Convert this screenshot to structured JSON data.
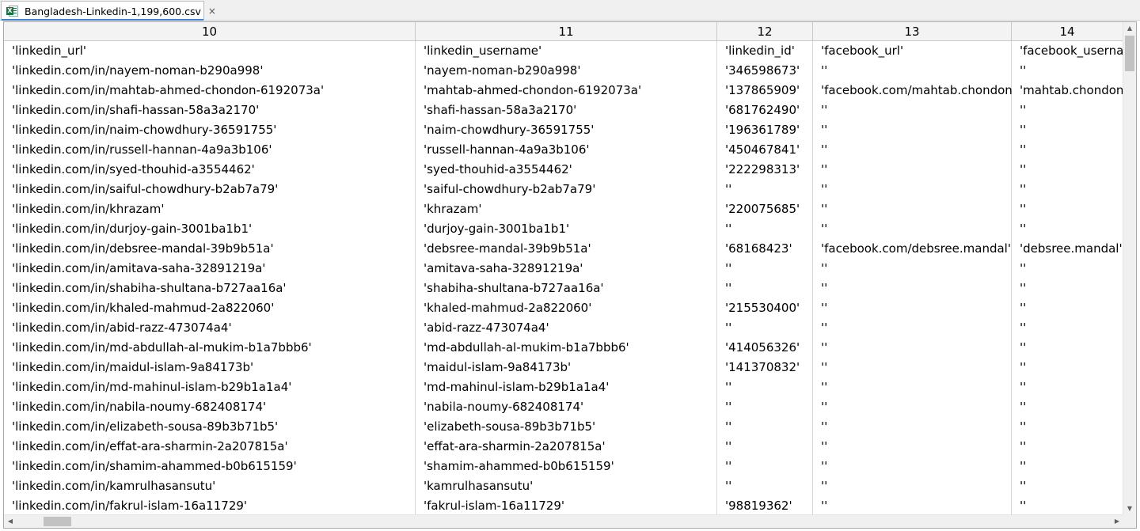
{
  "tab": {
    "title": "Bangladesh-Linkedin-1,199,600.csv",
    "close": "×",
    "icon": "excel-csv-icon",
    "icon_badge": "X"
  },
  "columns": [
    "10",
    "11",
    "12",
    "13",
    "14"
  ],
  "rows": [
    [
      "'linkedin_url'",
      "'linkedin_username'",
      "'linkedin_id'",
      "'facebook_url'",
      "'facebook_usernam"
    ],
    [
      "'linkedin.com/in/nayem-noman-b290a998'",
      "'nayem-noman-b290a998'",
      "'346598673'",
      "''",
      "''"
    ],
    [
      "'linkedin.com/in/mahtab-ahmed-chondon-6192073a'",
      "'mahtab-ahmed-chondon-6192073a'",
      "'137865909'",
      "'facebook.com/mahtab.chondon'",
      "'mahtab.chondon'"
    ],
    [
      "'linkedin.com/in/shafi-hassan-58a3a2170'",
      "'shafi-hassan-58a3a2170'",
      "'681762490'",
      "''",
      "''"
    ],
    [
      "'linkedin.com/in/naim-chowdhury-36591755'",
      "'naim-chowdhury-36591755'",
      "'196361789'",
      "''",
      "''"
    ],
    [
      "'linkedin.com/in/russell-hannan-4a9a3b106'",
      "'russell-hannan-4a9a3b106'",
      "'450467841'",
      "''",
      "''"
    ],
    [
      "'linkedin.com/in/syed-thouhid-a3554462'",
      "'syed-thouhid-a3554462'",
      "'222298313'",
      "''",
      "''"
    ],
    [
      "'linkedin.com/in/saiful-chowdhury-b2ab7a79'",
      "'saiful-chowdhury-b2ab7a79'",
      "''",
      "''",
      "''"
    ],
    [
      "'linkedin.com/in/khrazam'",
      "'khrazam'",
      "'220075685'",
      "''",
      "''"
    ],
    [
      "'linkedin.com/in/durjoy-gain-3001ba1b1'",
      "'durjoy-gain-3001ba1b1'",
      "''",
      "''",
      "''"
    ],
    [
      "'linkedin.com/in/debsree-mandal-39b9b51a'",
      "'debsree-mandal-39b9b51a'",
      "'68168423'",
      "'facebook.com/debsree.mandal'",
      "'debsree.mandal'"
    ],
    [
      "'linkedin.com/in/amitava-saha-32891219a'",
      "'amitava-saha-32891219a'",
      "''",
      "''",
      "''"
    ],
    [
      "'linkedin.com/in/shabiha-shultana-b727aa16a'",
      "'shabiha-shultana-b727aa16a'",
      "''",
      "''",
      "''"
    ],
    [
      "'linkedin.com/in/khaled-mahmud-2a822060'",
      "'khaled-mahmud-2a822060'",
      "'215530400'",
      "''",
      "''"
    ],
    [
      "'linkedin.com/in/abid-razz-473074a4'",
      "'abid-razz-473074a4'",
      "''",
      "''",
      "''"
    ],
    [
      "'linkedin.com/in/md-abdullah-al-mukim-b1a7bbb6'",
      "'md-abdullah-al-mukim-b1a7bbb6'",
      "'414056326'",
      "''",
      "''"
    ],
    [
      "'linkedin.com/in/maidul-islam-9a84173b'",
      "'maidul-islam-9a84173b'",
      "'141370832'",
      "''",
      "''"
    ],
    [
      "'linkedin.com/in/md-mahinul-islam-b29b1a1a4'",
      "'md-mahinul-islam-b29b1a1a4'",
      "''",
      "''",
      "''"
    ],
    [
      "'linkedin.com/in/nabila-noumy-682408174'",
      "'nabila-noumy-682408174'",
      "''",
      "''",
      "''"
    ],
    [
      "'linkedin.com/in/elizabeth-sousa-89b3b71b5'",
      "'elizabeth-sousa-89b3b71b5'",
      "''",
      "''",
      "''"
    ],
    [
      "'linkedin.com/in/effat-ara-sharmin-2a207815a'",
      "'effat-ara-sharmin-2a207815a'",
      "''",
      "''",
      "''"
    ],
    [
      "'linkedin.com/in/shamim-ahammed-b0b615159'",
      "'shamim-ahammed-b0b615159'",
      "''",
      "''",
      "''"
    ],
    [
      "'linkedin.com/in/kamrulhasansutu'",
      "'kamrulhasansutu'",
      "''",
      "''",
      "''"
    ],
    [
      "'linkedin.com/in/fakrul-islam-16a11729'",
      "'fakrul-islam-16a11729'",
      "'98819362'",
      "''",
      "''"
    ]
  ],
  "scroll": {
    "up": "▲",
    "down": "▼",
    "left": "◀",
    "right": "▶"
  },
  "colors": {
    "tab_accent": "#3c7fd6",
    "excel_green": "#1e7145"
  }
}
